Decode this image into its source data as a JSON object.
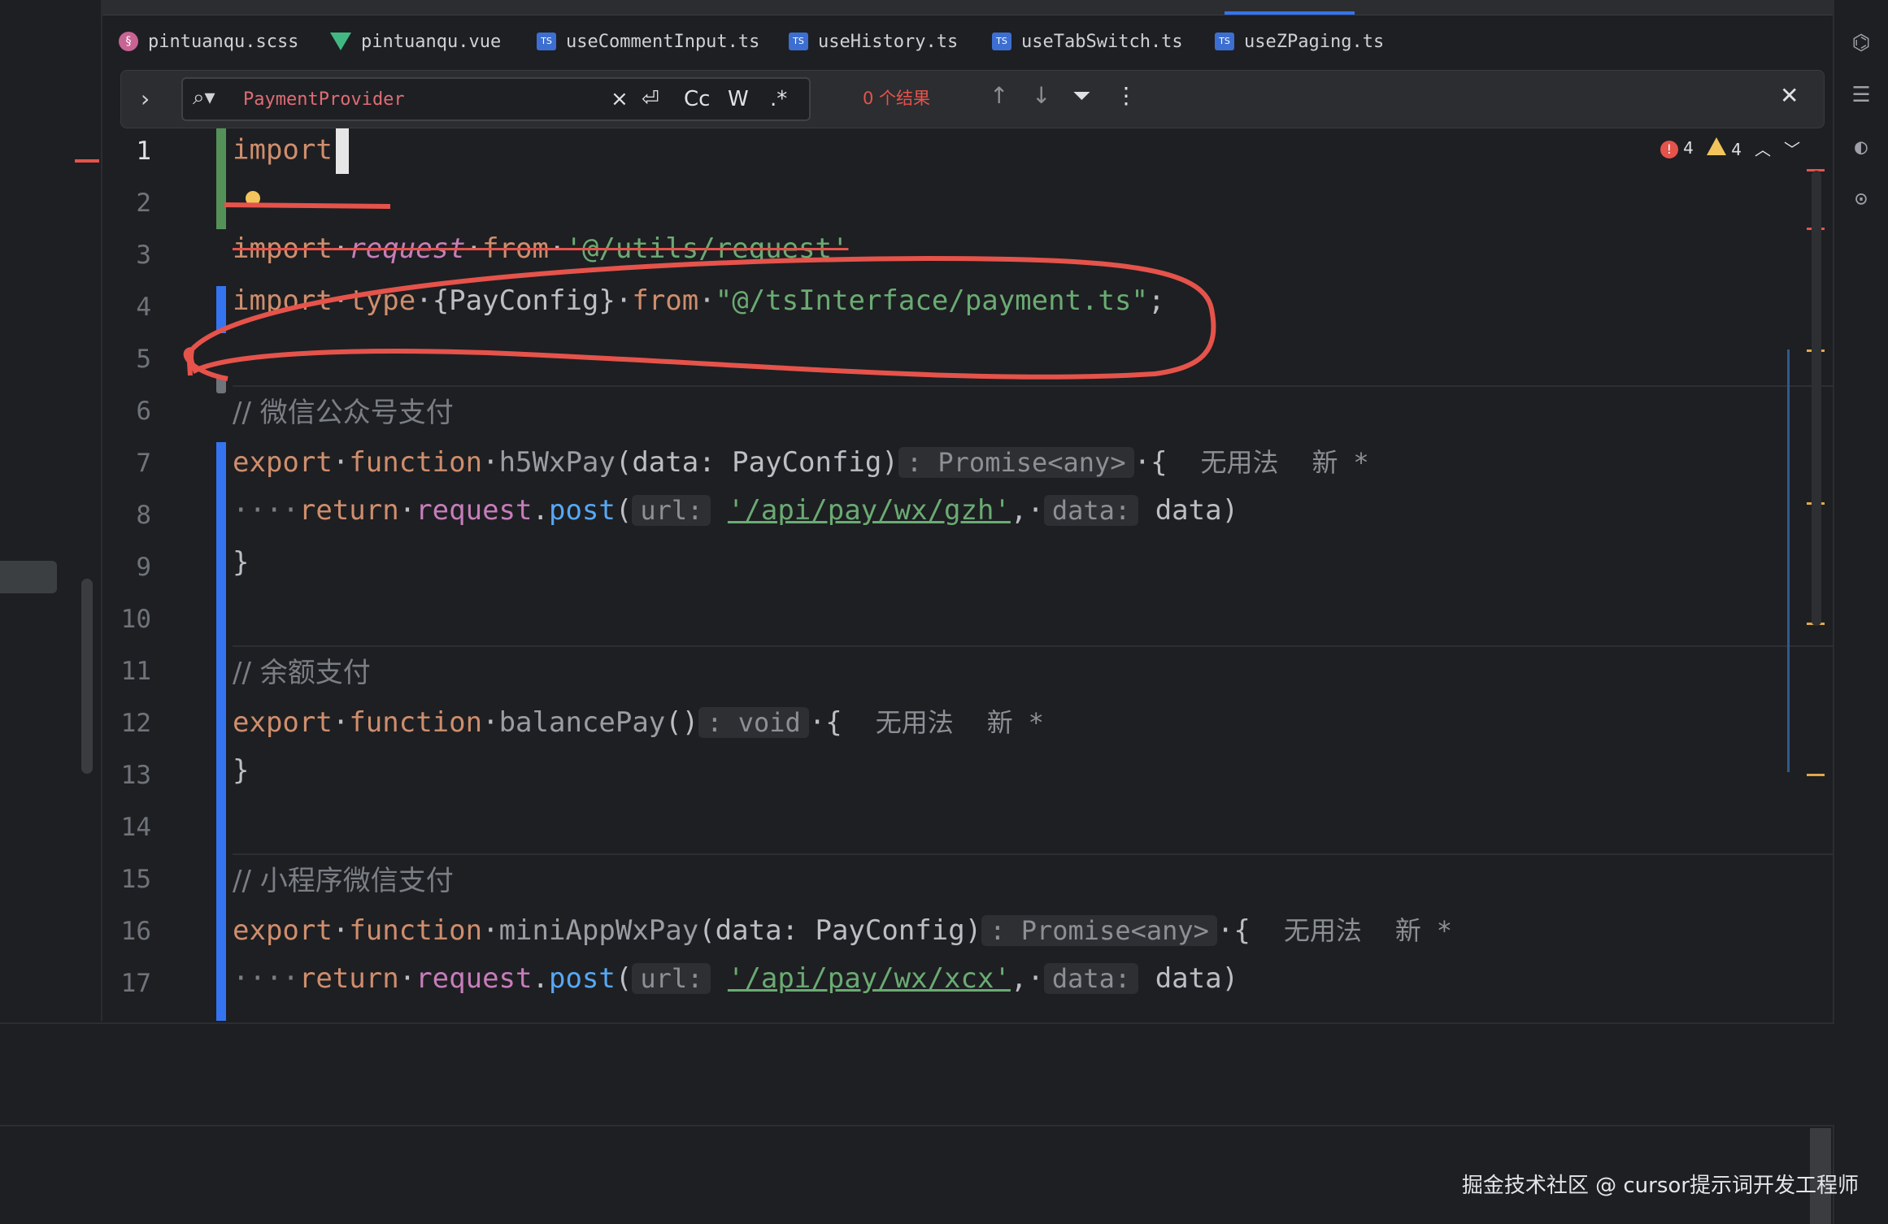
{
  "tabs": [
    {
      "label": "pintuanqu.scss",
      "icon": "scss-file-icon"
    },
    {
      "label": "pintuanqu.vue",
      "icon": "vue-file-icon"
    },
    {
      "label": "useCommentInput.ts",
      "icon": "ts-file-icon"
    },
    {
      "label": "useHistory.ts",
      "icon": "ts-file-icon"
    },
    {
      "label": "useTabSwitch.ts",
      "icon": "ts-file-icon"
    },
    {
      "label": "useZPaging.ts",
      "icon": "ts-file-icon"
    }
  ],
  "ts_badge": "TS",
  "find": {
    "query": "PaymentProvider",
    "opt_case": "Cc",
    "opt_word": "W",
    "opt_regex": ".*",
    "results": "0 个结果"
  },
  "inspections": {
    "errors": "4",
    "warnings": "4"
  },
  "line_numbers": [
    "1",
    "2",
    "3",
    "4",
    "5",
    "6",
    "7",
    "8",
    "9",
    "10",
    "11",
    "12",
    "13",
    "14",
    "15",
    "16",
    "17"
  ],
  "code": {
    "l1_kw": "import",
    "l3_import": "import",
    "l3_ident": "request",
    "l3_from": "from",
    "l3_path": "'@/utils/request'",
    "l4_import": "import",
    "l4_type": "type",
    "l4_brace": "{PayConfig}",
    "l4_from": "from",
    "l4_path": "\"@/tsInterface/payment.ts\"",
    "l4_semi": ";",
    "l6_comment": "// 微信公众号支付",
    "l7_export": "export",
    "l7_function": "function",
    "l7_name": "h5WxPay",
    "l7_params": "(data: PayConfig)",
    "l7_hint": ": Promise<any>",
    "l7_brace": "{",
    "l8_return": "return",
    "l8_obj": "request",
    "l8_dot": ".",
    "l8_method": "post",
    "l8_open": "(",
    "l8_hint_url": "url:",
    "l8_url": "'/api/pay/wx/gzh'",
    "l8_comma": ",",
    "l8_hint_data": "data:",
    "l8_arg": "data)",
    "l9_close": "}",
    "l11_comment": "// 余额支付",
    "l12_export": "export",
    "l12_function": "function",
    "l12_name": "balancePay",
    "l12_params": "()",
    "l12_hint": ": void",
    "l12_brace": "{",
    "l13_close": "}",
    "l15_comment": "// 小程序微信支付",
    "l16_export": "export",
    "l16_function": "function",
    "l16_name": "miniAppWxPay",
    "l16_params": "(data: PayConfig)",
    "l16_hint": ": Promise<any>",
    "l16_brace": "{",
    "l17_return": "return",
    "l17_obj": "request",
    "l17_dot": ".",
    "l17_method": "post",
    "l17_open": "(",
    "l17_hint_url": "url:",
    "l17_url": "'/api/pay/wx/xcx'",
    "l17_comma": ",",
    "l17_hint_data": "data:",
    "l17_arg": "data)"
  },
  "usages": {
    "no_usages": "无用法",
    "new": "新",
    "star": "*"
  },
  "watermark": "掘金技术社区 @ cursor提示词开发工程师",
  "colors": {
    "keyword": "#cf8e6d",
    "function": "#56a8f5",
    "string": "#6aab73",
    "comment": "#7a7e85",
    "annotation": "#e5534b"
  }
}
